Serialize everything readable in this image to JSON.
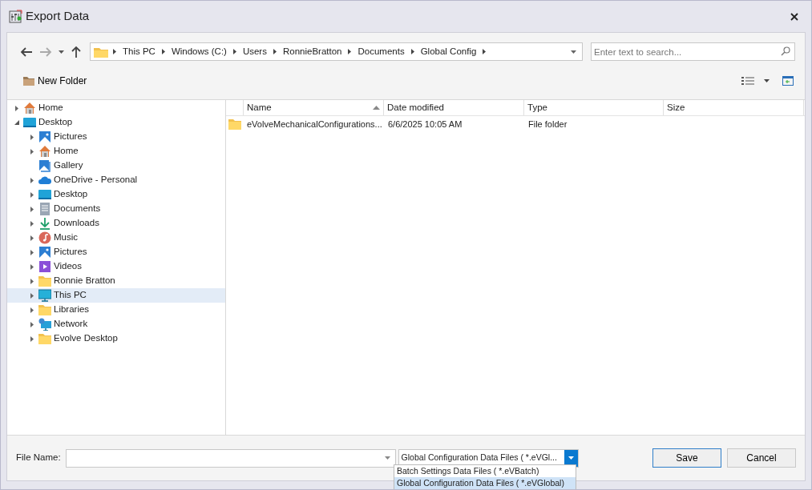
{
  "window": {
    "title": "Export Data"
  },
  "navigation": {
    "back_disabled": false,
    "forward_disabled": true
  },
  "address_bar": {
    "segments": [
      "This PC",
      "Windows (C:)",
      "Users",
      "RonnieBratton",
      "Documents",
      "Global Config"
    ]
  },
  "search": {
    "placeholder": "Enter text to search..."
  },
  "toolbar": {
    "new_folder": "New Folder"
  },
  "tree": [
    {
      "label": "Home",
      "kind": "home",
      "expandable": true,
      "expanded": false,
      "selected": false
    },
    {
      "label": "Desktop",
      "kind": "desktop",
      "expandable": true,
      "expanded": true,
      "selected": false,
      "children": [
        {
          "label": "Pictures",
          "kind": "pictures",
          "expandable": true,
          "expanded": false,
          "selected": false
        },
        {
          "label": "Home",
          "kind": "home",
          "expandable": true,
          "expanded": false,
          "selected": false
        },
        {
          "label": "Gallery",
          "kind": "gallery",
          "expandable": false,
          "selected": false
        },
        {
          "label": "OneDrive - Personal",
          "kind": "cloud",
          "expandable": true,
          "expanded": false,
          "selected": false
        },
        {
          "label": "Desktop",
          "kind": "desktop",
          "expandable": true,
          "expanded": false,
          "selected": false
        },
        {
          "label": "Documents",
          "kind": "documents",
          "expandable": true,
          "expanded": false,
          "selected": false
        },
        {
          "label": "Downloads",
          "kind": "downloads",
          "expandable": true,
          "expanded": false,
          "selected": false
        },
        {
          "label": "Music",
          "kind": "music",
          "expandable": true,
          "expanded": false,
          "selected": false
        },
        {
          "label": "Pictures",
          "kind": "pictures",
          "expandable": true,
          "expanded": false,
          "selected": false
        },
        {
          "label": "Videos",
          "kind": "videos",
          "expandable": true,
          "expanded": false,
          "selected": false
        },
        {
          "label": "Ronnie Bratton",
          "kind": "folder",
          "expandable": true,
          "expanded": false,
          "selected": false
        },
        {
          "label": "This PC",
          "kind": "pc",
          "expandable": true,
          "expanded": false,
          "selected": true
        },
        {
          "label": "Libraries",
          "kind": "folder",
          "expandable": true,
          "expanded": false,
          "selected": false
        },
        {
          "label": "Network",
          "kind": "network",
          "expandable": true,
          "expanded": false,
          "selected": false
        },
        {
          "label": "Evolve Desktop",
          "kind": "folder",
          "expandable": true,
          "expanded": false,
          "selected": false
        }
      ]
    }
  ],
  "file_list": {
    "columns": [
      {
        "label": "Name",
        "sorted": true
      },
      {
        "label": "Date modified",
        "sorted": false
      },
      {
        "label": "Type",
        "sorted": false
      },
      {
        "label": "Size",
        "sorted": false
      }
    ],
    "rows": [
      {
        "name": "eVolveMechanicalConfigurations...",
        "date_modified": "6/6/2025 10:05 AM",
        "type": "File folder"
      }
    ]
  },
  "file_name": {
    "label": "File Name:"
  },
  "file_type": {
    "value": "Global Configuration Data Files  ( *.eVGl...",
    "open": true,
    "options": [
      {
        "label": "Batch Settings Data Files  ( *.eVBatch)",
        "selected": false
      },
      {
        "label": "Global Configuration Data Files  ( *.eVGlobal)",
        "selected": true
      }
    ]
  },
  "buttons": [
    {
      "label": "Save",
      "default": true
    },
    {
      "label": "Cancel",
      "default": false
    }
  ]
}
